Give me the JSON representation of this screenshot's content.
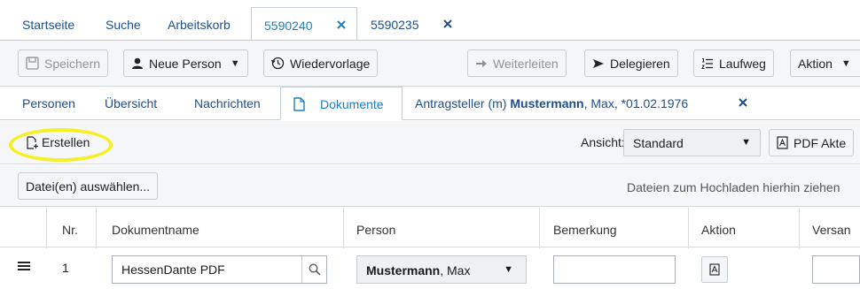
{
  "main_tabs": [
    {
      "label": "Startseite"
    },
    {
      "label": "Suche"
    },
    {
      "label": "Arbeitskorb"
    },
    {
      "label": "5590240"
    },
    {
      "label": "5590235"
    }
  ],
  "toolbar": {
    "save": "Speichern",
    "new_person": "Neue Person",
    "followup": "Wiedervorlage",
    "forward": "Weiterleiten",
    "delegate": "Delegieren",
    "route": "Laufweg",
    "action": "Aktion"
  },
  "sub_tabs": [
    {
      "label": "Personen"
    },
    {
      "label": "Übersicht"
    },
    {
      "label": "Nachrichten"
    },
    {
      "label": "Dokumente"
    }
  ],
  "person_tab": {
    "prefix": "Antragsteller  (m) ",
    "name": "Mustermann",
    "suffix": ", Max, *01.02.1976"
  },
  "docs_toolbar": {
    "create": "Erstellen",
    "view_label": "Ansicht:",
    "view_value": "Standard",
    "pdf": "PDF Akte"
  },
  "upload": {
    "choose": "Datei(en) auswählen...",
    "drop_hint": "Dateien zum Hochladen hierhin ziehen"
  },
  "table": {
    "headers": [
      "Nr.",
      "Dokumentname",
      "Person",
      "Bemerkung",
      "Aktion",
      "Versan"
    ],
    "rows": [
      {
        "nr": "1",
        "doc_name": "HessenDante PDF",
        "person_last": "Mustermann",
        "person_first": ", Max",
        "remark": ""
      }
    ]
  },
  "colors": {
    "link": "#1d4f8c",
    "active_tab": "#1d7fbf",
    "highlight": "#f4f023"
  }
}
